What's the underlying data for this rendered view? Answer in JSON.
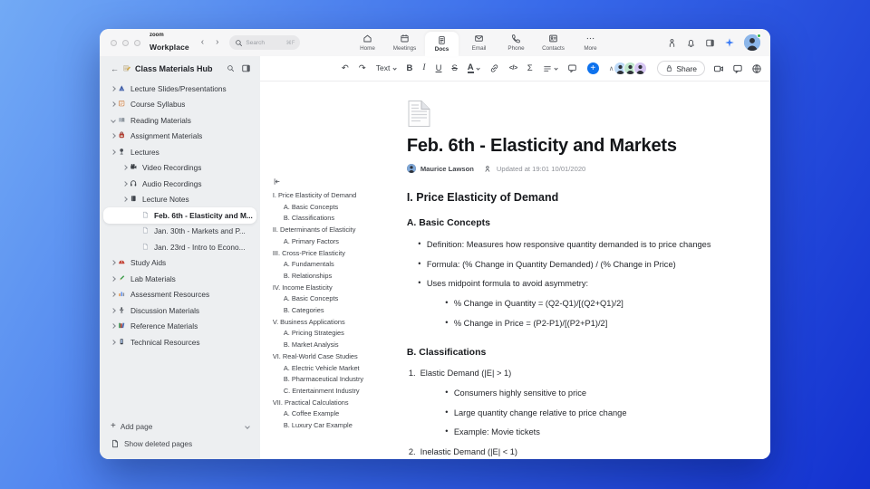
{
  "colors": {
    "accent_blue": "#0E72ED",
    "background_gradient": [
      "#72aaf5",
      "#1331cf"
    ],
    "sidebar_bg": "#edeff1",
    "titlebar_bg": "#f6f6f7",
    "status_green": "#2fb344"
  },
  "titlebar": {
    "logo_line1": "zoom",
    "logo_line2": "Workplace",
    "back_glyph": "‹",
    "forward_glyph": "›",
    "search": {
      "placeholder": "Search",
      "shortcut": "⌘F"
    },
    "tabs": [
      {
        "label": "Home",
        "icon": "home-icon",
        "active": false
      },
      {
        "label": "Meetings",
        "icon": "calendar-icon",
        "active": false
      },
      {
        "label": "Docs",
        "icon": "doc-icon",
        "active": true
      },
      {
        "label": "Email",
        "icon": "mail-icon",
        "active": false
      },
      {
        "label": "Phone",
        "icon": "phone-icon",
        "active": false
      },
      {
        "label": "Contacts",
        "icon": "contacts-icon",
        "active": false
      },
      {
        "label": "More",
        "icon": "more-dots-icon",
        "active": false
      }
    ],
    "right_icons": [
      "workspace-rooms-icon",
      "bell-icon",
      "panel-icon",
      "sparkle-icon"
    ]
  },
  "sidebar": {
    "back_glyph": "←",
    "hub_icon": "notebook-pencil-icon",
    "title": "Class Materials Hub",
    "header_icons": [
      "search-icon",
      "panel-icon"
    ],
    "items": [
      {
        "label": "Lecture Slides/Presentations",
        "level": 0,
        "chevron": "right",
        "icon": "slides-icon",
        "active": false
      },
      {
        "label": "Course Syllabus",
        "level": 0,
        "chevron": "right",
        "icon": "syllabus-icon",
        "active": false
      },
      {
        "label": "Reading Materials",
        "level": 0,
        "chevron": "down",
        "icon": "reading-book-icon",
        "active": false
      },
      {
        "label": "Assignment Materials",
        "level": 0,
        "chevron": "right",
        "icon": "backpack-icon",
        "active": false
      },
      {
        "label": "Lectures",
        "level": 0,
        "chevron": "right",
        "icon": "lectures-icon",
        "active": false
      },
      {
        "label": "Video Recordings",
        "level": 1,
        "chevron": "right",
        "icon": "video-camera-icon",
        "active": false
      },
      {
        "label": "Audio Recordings",
        "level": 1,
        "chevron": "right",
        "icon": "headphones-icon",
        "active": false
      },
      {
        "label": "Lecture Notes",
        "level": 1,
        "chevron": "right",
        "icon": "notebook-icon",
        "active": false
      },
      {
        "label": "Feb. 6th - Elasticity and M...",
        "level": 2,
        "chevron": "none",
        "icon": "page-icon",
        "active": true
      },
      {
        "label": "Jan. 30th - Markets and P...",
        "level": 2,
        "chevron": "none",
        "icon": "page-icon",
        "active": false
      },
      {
        "label": "Jan. 23rd - Intro to Econo...",
        "level": 2,
        "chevron": "none",
        "icon": "page-icon",
        "active": false
      },
      {
        "label": "Study Aids",
        "level": 0,
        "chevron": "right",
        "icon": "helmet-icon",
        "active": false
      },
      {
        "label": "Lab Materials",
        "level": 0,
        "chevron": "right",
        "icon": "pencil-icon",
        "active": false
      },
      {
        "label": "Assessment Resources",
        "level": 0,
        "chevron": "right",
        "icon": "bar-chart-icon",
        "active": false
      },
      {
        "label": "Discussion Materials",
        "level": 0,
        "chevron": "right",
        "icon": "microphone-icon",
        "active": false
      },
      {
        "label": "Reference Materials",
        "level": 0,
        "chevron": "right",
        "icon": "books-icon",
        "active": false
      },
      {
        "label": "Technical Resources",
        "level": 0,
        "chevron": "right",
        "icon": "phone-device-icon",
        "active": false
      }
    ],
    "footer": {
      "add_glyph": "+",
      "add_page": "Add page",
      "show_deleted": "Show deleted pages",
      "deleted_icon": "deleted-page-icon"
    }
  },
  "doc_toolbar": {
    "glyphs": {
      "undo": "↶",
      "redo": "↷",
      "bold": "B",
      "italic": "I",
      "underline": "U",
      "strike": "S",
      "color": "A",
      "code": "</>",
      "equation": "Σ",
      "plus": "+",
      "collapse": "∧",
      "more": "⋯"
    },
    "text_style_label": "Text",
    "share_label": "Share",
    "collaborators": [
      {
        "bg": "#bcd9f7"
      },
      {
        "bg": "#bfe6cb"
      },
      {
        "bg": "#d6c6f2"
      }
    ],
    "right_icons": [
      "video-call-icon",
      "chat-bubble-icon",
      "globe-icon"
    ]
  },
  "toc": {
    "items": [
      {
        "label": "I. Price Elasticity of Demand",
        "level": 0
      },
      {
        "label": "A. Basic Concepts",
        "level": 1
      },
      {
        "label": "B. Classifications",
        "level": 1
      },
      {
        "label": "II. Determinants of Elasticity",
        "level": 0
      },
      {
        "label": "A. Primary Factors",
        "level": 1
      },
      {
        "label": "III. Cross-Price Elasticity",
        "level": 0
      },
      {
        "label": "A. Fundamentals",
        "level": 1
      },
      {
        "label": "B. Relationships",
        "level": 1
      },
      {
        "label": "IV. Income Elasticity",
        "level": 0
      },
      {
        "label": "A. Basic Concepts",
        "level": 1
      },
      {
        "label": "B. Categories",
        "level": 1
      },
      {
        "label": "V. Business Applications",
        "level": 0
      },
      {
        "label": "A. Pricing Strategies",
        "level": 1
      },
      {
        "label": "B. Market Analysis",
        "level": 1
      },
      {
        "label": "VI. Real-World Case Studies",
        "level": 0
      },
      {
        "label": "A. Electric Vehicle Market",
        "level": 1
      },
      {
        "label": "B. Pharmaceutical Industry",
        "level": 1
      },
      {
        "label": "C. Entertainment Industry",
        "level": 1
      },
      {
        "label": "VII. Practical Calculations",
        "level": 0
      },
      {
        "label": "A. Coffee Example",
        "level": 1
      },
      {
        "label": "B. Luxury Car Example",
        "level": 1
      }
    ]
  },
  "document": {
    "title": "Feb. 6th - Elasticity and Markets",
    "author": "Maurice Lawson",
    "updated": "Updated at 19:01 10/01/2020",
    "blocks": [
      {
        "type": "h2",
        "text": "I. Price Elasticity of Demand"
      },
      {
        "type": "h3",
        "text": "A. Basic Concepts"
      },
      {
        "type": "bullet",
        "level": 1,
        "text": "Definition: Measures how responsive quantity demanded is to price changes"
      },
      {
        "type": "bullet",
        "level": 1,
        "text": "Formula: (% Change in Quantity Demanded) / (% Change in Price)"
      },
      {
        "type": "bullet",
        "level": 1,
        "text": "Uses midpoint formula to avoid asymmetry:"
      },
      {
        "type": "bullet",
        "level": 2,
        "text": "% Change in Quantity = (Q2-Q1)/[(Q2+Q1)/2]"
      },
      {
        "type": "bullet",
        "level": 2,
        "text": "% Change in Price = (P2-P1)/[(P2+P1)/2]"
      },
      {
        "type": "h3",
        "text": "B. Classifications",
        "spacing": "lg"
      },
      {
        "type": "numbered",
        "marker": "1.",
        "text": "Elastic Demand (|E| > 1)"
      },
      {
        "type": "bullet",
        "level": 2,
        "text": "Consumers highly sensitive to price"
      },
      {
        "type": "bullet",
        "level": 2,
        "text": "Large quantity change relative to price change"
      },
      {
        "type": "bullet",
        "level": 2,
        "text": "Example: Movie tickets"
      },
      {
        "type": "numbered",
        "marker": "2.",
        "text": "Inelastic Demand (|E| < 1)"
      }
    ]
  }
}
